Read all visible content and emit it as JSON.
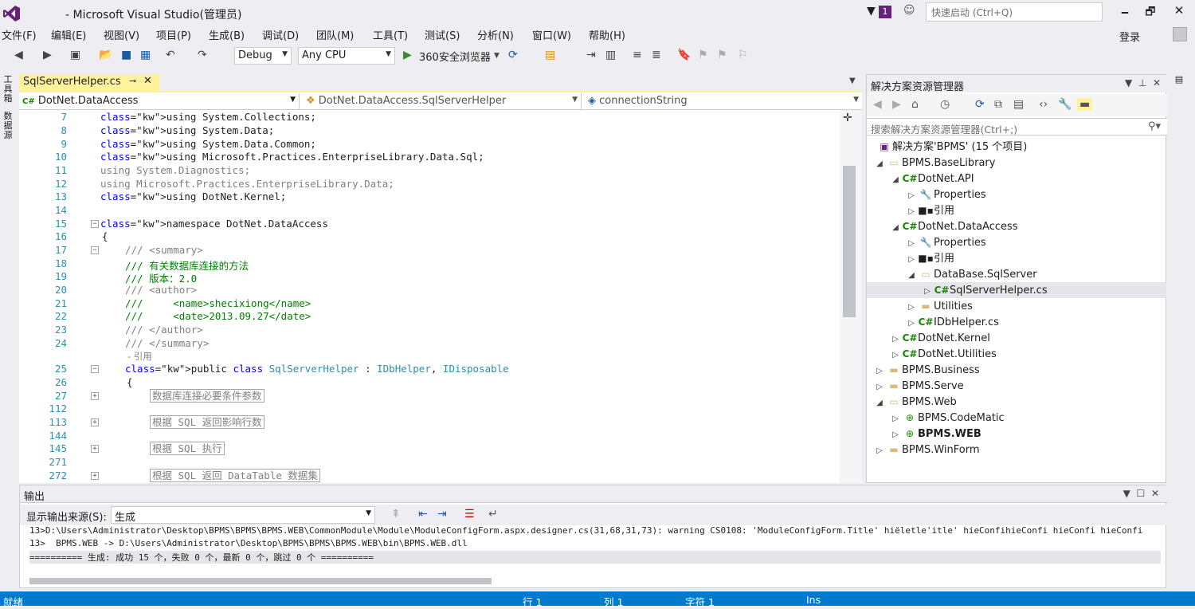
{
  "window": {
    "title": "- Microsoft Visual Studio(管理员)",
    "notification_count": "1",
    "quick_launch_placeholder": "快速启动 (Ctrl+Q)",
    "min": "🗕",
    "max": "🗗",
    "close": "✕",
    "accent": "#68217a"
  },
  "menu": [
    "文件(F)",
    "编辑(E)",
    "视图(V)",
    "项目(P)",
    "生成(B)",
    "调试(D)",
    "团队(M)",
    "工具(T)",
    "测试(S)",
    "分析(N)",
    "窗口(W)",
    "帮助(H)"
  ],
  "account": {
    "login": "登录"
  },
  "toolbar": {
    "config": "Debug",
    "platform": "Any CPU",
    "run_label": "360安全浏览器"
  },
  "left_strip": {
    "toolbox": "工具箱",
    "datasource": "数据源"
  },
  "doc_tab": {
    "label": "SqlServerHelper.cs"
  },
  "navbar": {
    "project": "DotNet.DataAccess",
    "class": "DotNet.DataAccess.SqlServerHelper",
    "member": "connectionString"
  },
  "code_lines": [
    {
      "n": "7",
      "text": "using System.Collections;"
    },
    {
      "n": "8",
      "text": "using System.Data;"
    },
    {
      "n": "9",
      "text": "using System.Data.Common;"
    },
    {
      "n": "10",
      "text": "using Microsoft.Practices.EnterpriseLibrary.Data.Sql;"
    },
    {
      "n": "11",
      "text": "using System.Diagnostics;"
    },
    {
      "n": "12",
      "text": "using Microsoft.Practices.EnterpriseLibrary.Data;"
    },
    {
      "n": "13",
      "text": "using DotNet.Kernel;"
    },
    {
      "n": "14",
      "text": ""
    },
    {
      "n": "15",
      "text": "namespace DotNet.DataAccess"
    },
    {
      "n": "16",
      "text": "{"
    },
    {
      "n": "17",
      "text": "/// <summary>"
    },
    {
      "n": "18",
      "text": "/// 有关数据库连接的方法"
    },
    {
      "n": "19",
      "text": "/// 版本：2.0"
    },
    {
      "n": "20",
      "text": "/// <author>"
    },
    {
      "n": "21",
      "text": "///     <name>shecixiong</name>"
    },
    {
      "n": "22",
      "text": "///     <date>2013.09.27</date>"
    },
    {
      "n": "23",
      "text": "/// </author>"
    },
    {
      "n": "24",
      "text": "/// </summary>"
    },
    {
      "n": "",
      "text": "- 引用"
    },
    {
      "n": "25",
      "text": "public class SqlServerHelper : IDbHelper, IDisposable"
    },
    {
      "n": "26",
      "text": "{"
    },
    {
      "n": "27",
      "text": "数据库连接必要条件参数"
    },
    {
      "n": "112",
      "text": ""
    },
    {
      "n": "113",
      "text": "根据 SQL 返回影响行数"
    },
    {
      "n": "144",
      "text": ""
    },
    {
      "n": "145",
      "text": "根据 SQL 执行"
    },
    {
      "n": "271",
      "text": ""
    },
    {
      "n": "272",
      "text": "根据 SQL 返回 DataTable 数据集"
    }
  ],
  "solution_explorer": {
    "title": "解决方案资源管理器",
    "search_placeholder": "搜索解决方案资源管理器(Ctrl+;)",
    "items": [
      {
        "label": "解决方案'BPMS' (15 个项目)"
      },
      {
        "label": "BPMS.BaseLibrary"
      },
      {
        "label": "DotNet.API"
      },
      {
        "label": "Properties"
      },
      {
        "label": "引用"
      },
      {
        "label": "DotNet.DataAccess"
      },
      {
        "label": "Properties"
      },
      {
        "label": "引用"
      },
      {
        "label": "DataBase.SqlServer"
      },
      {
        "label": "SqlServerHelper.cs"
      },
      {
        "label": "Utilities"
      },
      {
        "label": "IDbHelper.cs"
      },
      {
        "label": "DotNet.Kernel"
      },
      {
        "label": "DotNet.Utilities"
      },
      {
        "label": "BPMS.Business"
      },
      {
        "label": "BPMS.Serve"
      },
      {
        "label": "BPMS.Web"
      },
      {
        "label": "BPMS.CodeMatic"
      },
      {
        "label": "BPMS.WEB"
      },
      {
        "label": "BPMS.WinForm"
      }
    ]
  },
  "output": {
    "title": "输出",
    "source_label": "显示输出来源(S):",
    "source_value": "生成",
    "lines": [
      "13>D:\\Users\\Administrator\\Desktop\\BPMS\\BPMS\\BPMS.WEB\\CommonModule\\Module\\ModuleConfigForm.aspx.designer.cs(31,68,31,73): warning CS0108: 'ModuleConfigForm.Title' hiёletle'itle' hieConfihieConfi hieConfi hieConfi",
      "13>  BPMS.WEB -> D:\\Users\\Administrator\\Desktop\\BPMS\\BPMS\\BPMS.WEB\\bin\\BPMS.WEB.dll",
      "========== 生成: 成功 15 个，失败 0 个，最新 0 个，跳过 0 个 =========="
    ]
  },
  "status": {
    "ready": "就绪",
    "line": "行 1",
    "col": "列 1",
    "char": "字符 1",
    "ins": "Ins",
    "bar_color": "#007acc"
  }
}
